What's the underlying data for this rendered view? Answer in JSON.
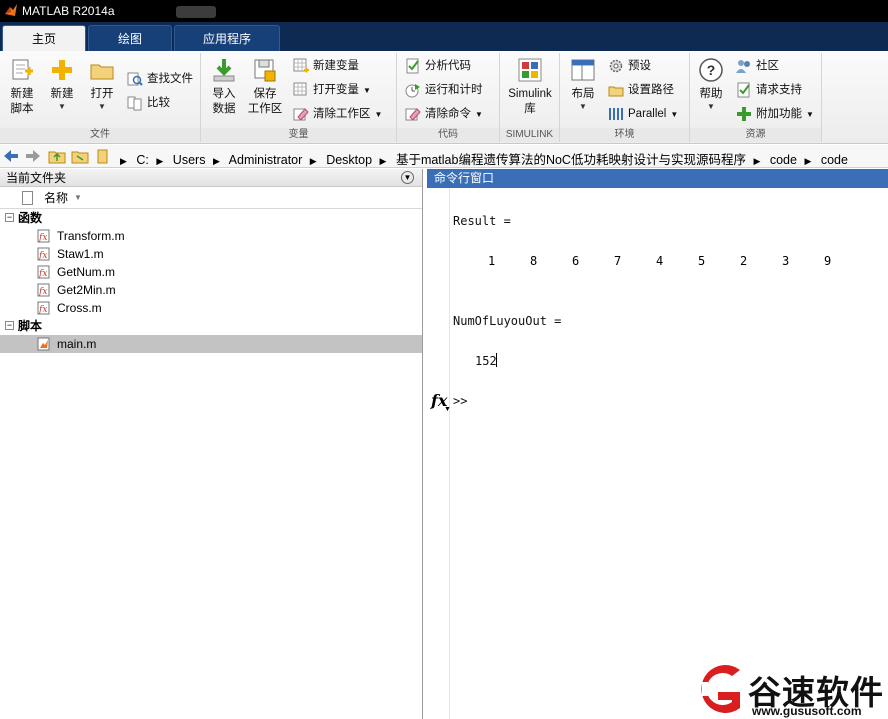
{
  "window": {
    "title": "MATLAB R2014a"
  },
  "tabs": [
    {
      "label": "主页"
    },
    {
      "label": "绘图"
    },
    {
      "label": "应用程序"
    }
  ],
  "ribbon": {
    "file": {
      "group_label": "文件",
      "new_script_line1": "新建",
      "new_script_line2": "脚本",
      "new_label": "新建",
      "open_label": "打开",
      "find_files_label": "查找文件",
      "compare_label": "比较"
    },
    "variable": {
      "group_label": "变量",
      "import_line1": "导入",
      "import_line2": "数据",
      "save_line1": "保存",
      "save_line2": "工作区",
      "new_variable_label": "新建变量",
      "open_variable_label": "打开变量",
      "clear_workspace_label": "清除工作区"
    },
    "code": {
      "group_label": "代码",
      "analyze_label": "分析代码",
      "run_time_label": "运行和计时",
      "clear_commands_label": "清除命令"
    },
    "simulink": {
      "group_label": "SIMULINK",
      "library_line1": "Simulink",
      "library_line2": "库"
    },
    "environment": {
      "group_label": "环境",
      "layout_label": "布局",
      "preferences_label": "预设",
      "set_path_label": "设置路径",
      "parallel_label": "Parallel"
    },
    "resources": {
      "group_label": "资源",
      "help_label": "帮助",
      "community_label": "社区",
      "support_label": "请求支持",
      "addons_label": "附加功能"
    }
  },
  "address": {
    "crumbs": [
      "C:",
      "Users",
      "Administrator",
      "Desktop",
      "基于matlab编程遗传算法的NoC低功耗映射设计与实现源码程序",
      "code",
      "code"
    ]
  },
  "file_browser": {
    "title": "当前文件夹",
    "column_name": "名称",
    "groups": [
      {
        "label": "函数",
        "toggle": "−",
        "files": [
          "Transform.m",
          "Staw1.m",
          "GetNum.m",
          "Get2Min.m",
          "Cross.m"
        ]
      },
      {
        "label": "脚本",
        "toggle": "−",
        "files": [
          "main.m"
        ]
      }
    ],
    "selected_file": "main.m"
  },
  "command_window": {
    "title": "命令行窗口",
    "result_label": "Result =",
    "result_values": [
      "1",
      "8",
      "6",
      "7",
      "4",
      "5",
      "2",
      "3",
      "9"
    ],
    "num_label": "NumOfLuyouOut =",
    "num_value": "152",
    "prompt": ">>",
    "fx_label": "fx"
  },
  "watermark": {
    "text": "谷速软件",
    "url": "www.gususoft.com"
  },
  "colors": {
    "tab_bar": "#0e2a52",
    "command_header": "#3a6eb7",
    "selected_row": "#c3c3c3",
    "watermark_red": "#d81e1e"
  }
}
